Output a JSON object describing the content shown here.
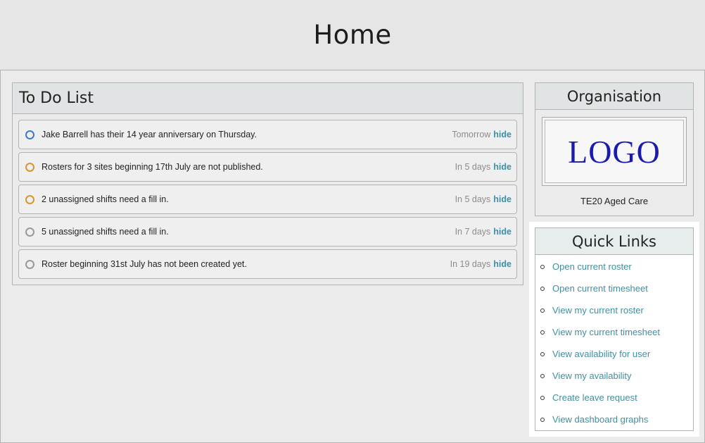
{
  "header": {
    "title": "Home"
  },
  "todo": {
    "title": "To Do List",
    "hide_label": "hide",
    "items": [
      {
        "text": "Jake Barrell has their 14 year anniversary on Thursday.",
        "when": "Tomorrow",
        "color": "#3b7bc8"
      },
      {
        "text": "Rosters for 3 sites beginning 17th July are not published.",
        "when": "In 5 days",
        "color": "#d9962e"
      },
      {
        "text": "2 unassigned shifts need a fill in.",
        "when": "In 5 days",
        "color": "#d9962e"
      },
      {
        "text": "5 unassigned shifts need a fill in.",
        "when": "In 7 days",
        "color": "#9a9a9a"
      },
      {
        "text": "Roster beginning 31st July has not been created yet.",
        "when": "In 19 days",
        "color": "#9a9a9a"
      }
    ]
  },
  "organisation": {
    "title": "Organisation",
    "logo_text": "LOGO",
    "name": "TE20 Aged Care"
  },
  "quick_links": {
    "title": "Quick Links",
    "links": [
      "Open current roster",
      "Open current timesheet",
      "View my current roster",
      "View my current timesheet",
      "View availability for user",
      "View my availability",
      "Create leave request",
      "View dashboard graphs"
    ]
  }
}
